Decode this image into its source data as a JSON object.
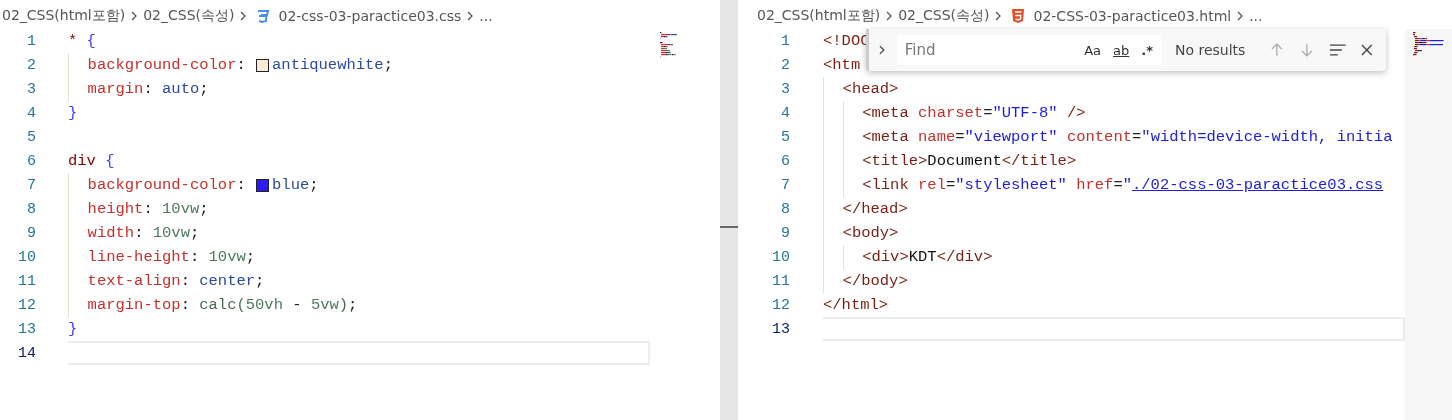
{
  "panes": [
    {
      "breadcrumbs": [
        {
          "kind": "folder",
          "label": "02_CSS(html포함)"
        },
        {
          "kind": "folder",
          "label": "02_CSS(속성)"
        },
        {
          "kind": "css-file",
          "label": "02-css-03-paractice03.css"
        },
        {
          "kind": "more",
          "label": "..."
        }
      ],
      "lines": [
        {
          "number": "1",
          "current": false,
          "tokens": [
            {
              "kind": "selector",
              "text": "* "
            },
            {
              "kind": "brace",
              "text": "{"
            }
          ]
        },
        {
          "number": "2",
          "current": false,
          "tokens": [
            {
              "kind": "prop",
              "text": "  background-color"
            },
            {
              "kind": "punct",
              "text": ": "
            },
            {
              "kind": "swatch",
              "color": "#faebd7"
            },
            {
              "kind": "value",
              "text": "antiquewhite"
            },
            {
              "kind": "punct",
              "text": ";"
            }
          ]
        },
        {
          "number": "3",
          "current": false,
          "tokens": [
            {
              "kind": "prop",
              "text": "  margin"
            },
            {
              "kind": "punct",
              "text": ": "
            },
            {
              "kind": "value",
              "text": "auto"
            },
            {
              "kind": "punct",
              "text": ";"
            }
          ]
        },
        {
          "number": "4",
          "current": false,
          "tokens": [
            {
              "kind": "brace",
              "text": "}"
            }
          ]
        },
        {
          "number": "5",
          "current": false
        },
        {
          "number": "6",
          "current": false,
          "tokens": [
            {
              "kind": "selector",
              "text": "div "
            },
            {
              "kind": "brace",
              "text": "{"
            }
          ]
        },
        {
          "number": "7",
          "current": false,
          "tokens": [
            {
              "kind": "prop",
              "text": "  background-color"
            },
            {
              "kind": "punct",
              "text": ": "
            },
            {
              "kind": "swatch",
              "color": "#2b1cf5"
            },
            {
              "kind": "value",
              "text": "blue"
            },
            {
              "kind": "punct",
              "text": ";"
            }
          ]
        },
        {
          "number": "8",
          "current": false,
          "tokens": [
            {
              "kind": "prop",
              "text": "  height"
            },
            {
              "kind": "punct",
              "text": ": "
            },
            {
              "kind": "number",
              "text": "10vw"
            },
            {
              "kind": "punct",
              "text": ";"
            }
          ]
        },
        {
          "number": "9",
          "current": false,
          "tokens": [
            {
              "kind": "prop",
              "text": "  width"
            },
            {
              "kind": "punct",
              "text": ": "
            },
            {
              "kind": "number",
              "text": "10vw"
            },
            {
              "kind": "punct",
              "text": ";"
            }
          ]
        },
        {
          "number": "10",
          "current": false,
          "tokens": [
            {
              "kind": "prop",
              "text": "  line-height"
            },
            {
              "kind": "punct",
              "text": ": "
            },
            {
              "kind": "number",
              "text": "10vw"
            },
            {
              "kind": "punct",
              "text": ";"
            }
          ]
        },
        {
          "number": "11",
          "current": false,
          "tokens": [
            {
              "kind": "prop",
              "text": "  text-align"
            },
            {
              "kind": "punct",
              "text": ": "
            },
            {
              "kind": "value",
              "text": "center"
            },
            {
              "kind": "punct",
              "text": ";"
            }
          ]
        },
        {
          "number": "12",
          "current": false,
          "tokens": [
            {
              "kind": "prop",
              "text": "  margin-top"
            },
            {
              "kind": "punct",
              "text": ": "
            },
            {
              "kind": "func",
              "text": "calc("
            },
            {
              "kind": "number",
              "text": "50vh"
            },
            {
              "kind": "punct",
              "text": " - "
            },
            {
              "kind": "number",
              "text": "5vw"
            },
            {
              "kind": "func",
              "text": ")"
            },
            {
              "kind": "punct",
              "text": ";"
            }
          ]
        },
        {
          "number": "13",
          "current": false,
          "tokens": [
            {
              "kind": "brace",
              "text": "}"
            }
          ]
        },
        {
          "number": "14",
          "current": true
        }
      ]
    },
    {
      "breadcrumbs": [
        {
          "kind": "folder",
          "label": "02_CSS(html포함)"
        },
        {
          "kind": "folder",
          "label": "02_CSS(속성)"
        },
        {
          "kind": "html-file",
          "label": "02-CSS-03-paractice03.html"
        },
        {
          "kind": "more",
          "label": "..."
        }
      ],
      "lines": [
        {
          "number": "1",
          "current": false,
          "tokens": [
            {
              "kind": "tag",
              "text": "<!DOC"
            }
          ]
        },
        {
          "number": "2",
          "current": false,
          "tokens": [
            {
              "kind": "tag",
              "text": "<htm"
            }
          ]
        },
        {
          "number": "3",
          "current": false,
          "tokens": [
            {
              "kind": "tag",
              "text": "  <head>"
            }
          ]
        },
        {
          "number": "4",
          "current": false,
          "tokens": [
            {
              "kind": "tag",
              "text": "    <meta "
            },
            {
              "kind": "attr",
              "text": "charset"
            },
            {
              "kind": "punct",
              "text": "="
            },
            {
              "kind": "string",
              "text": "\"UTF-8\""
            },
            {
              "kind": "tag",
              "text": " />"
            }
          ]
        },
        {
          "number": "5",
          "current": false,
          "tokens": [
            {
              "kind": "tag",
              "text": "    <meta "
            },
            {
              "kind": "attr",
              "text": "name"
            },
            {
              "kind": "punct",
              "text": "="
            },
            {
              "kind": "string",
              "text": "\"viewport\" "
            },
            {
              "kind": "attr",
              "text": "content"
            },
            {
              "kind": "punct",
              "text": "="
            },
            {
              "kind": "string",
              "text": "\"width=device-width, initia"
            }
          ]
        },
        {
          "number": "6",
          "current": false,
          "tokens": [
            {
              "kind": "tag",
              "text": "    <title>"
            },
            {
              "kind": "text",
              "text": "Document"
            },
            {
              "kind": "tag",
              "text": "</title>"
            }
          ]
        },
        {
          "number": "7",
          "current": false,
          "tokens": [
            {
              "kind": "tag",
              "text": "    <link "
            },
            {
              "kind": "attr",
              "text": "rel"
            },
            {
              "kind": "punct",
              "text": "="
            },
            {
              "kind": "string",
              "text": "\"stylesheet\" "
            },
            {
              "kind": "attr",
              "text": "href"
            },
            {
              "kind": "punct",
              "text": "="
            },
            {
              "kind": "string",
              "text": "\""
            },
            {
              "kind": "link",
              "text": "./02-css-03-paractice03.css"
            }
          ]
        },
        {
          "number": "8",
          "current": false,
          "tokens": [
            {
              "kind": "tag",
              "text": "  </head>"
            }
          ]
        },
        {
          "number": "9",
          "current": false,
          "tokens": [
            {
              "kind": "tag",
              "text": "  <body>"
            }
          ]
        },
        {
          "number": "10",
          "current": false,
          "tokens": [
            {
              "kind": "tag",
              "text": "    <div>"
            },
            {
              "kind": "text",
              "text": "KDT"
            },
            {
              "kind": "tag",
              "text": "</div>"
            }
          ]
        },
        {
          "number": "11",
          "current": false,
          "tokens": [
            {
              "kind": "tag",
              "text": "  </body>"
            }
          ]
        },
        {
          "number": "12",
          "current": false,
          "tokens": [
            {
              "kind": "tag",
              "text": "</html>"
            }
          ]
        },
        {
          "number": "13",
          "current": true
        }
      ],
      "find_widget": {
        "placeholder": "Find",
        "options": [
          {
            "kind": "case",
            "label": "Aa"
          },
          {
            "kind": "word",
            "label": "ab"
          },
          {
            "kind": "regex",
            "label": ".*"
          }
        ],
        "status": "No results"
      }
    }
  ]
}
